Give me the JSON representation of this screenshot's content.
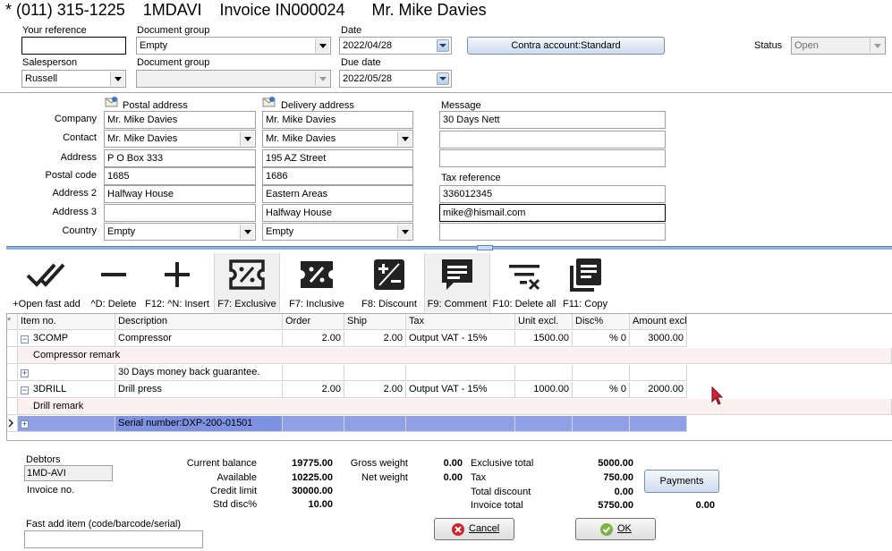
{
  "window": {
    "title": "* (011) 315-1225    1MDAVI    Invoice IN000024      Mr. Mike Davies"
  },
  "header": {
    "your_reference": {
      "label": "Your reference",
      "value": ""
    },
    "document_group1": {
      "label": "Document group",
      "value": "Empty"
    },
    "date": {
      "label": "Date",
      "value": "2022/04/28"
    },
    "contra_button": "Contra account:Standard",
    "status": {
      "label": "Status",
      "value": "Open"
    },
    "salesperson": {
      "label": "Salesperson",
      "value": "Russell"
    },
    "document_group2": {
      "label": "Document group",
      "value": ""
    },
    "due_date": {
      "label": "Due date",
      "value": "2022/05/28"
    }
  },
  "address": {
    "postal_header": "Postal address",
    "delivery_header": "Delivery address",
    "message_header": "Message",
    "tax_reference_header": "Tax reference",
    "row_labels": [
      "Company",
      "Contact",
      "Address",
      "Postal code",
      "Address 2",
      "Address 3",
      "Country"
    ],
    "postal": [
      "Mr. Mike Davies",
      "Mr. Mike Davies",
      "P O Box 333",
      "1685",
      "Halfway House",
      "",
      "Empty"
    ],
    "delivery": [
      "Mr. Mike Davies",
      "Mr. Mike Davies",
      "195 AZ Street",
      "1686",
      "Eastern Areas",
      "Halfway House",
      "Empty"
    ],
    "message": [
      "30 Days Nett",
      "",
      ""
    ],
    "tax_reference": "336012345",
    "email": "mike@hismail.com",
    "extra": ""
  },
  "toolbar": [
    {
      "label": "+Open fast add",
      "icon": "double-check-icon"
    },
    {
      "label": "^D: Delete",
      "icon": "minus-icon"
    },
    {
      "label": "F12: ^N: Insert",
      "icon": "plus-icon"
    },
    {
      "label": "F7: Exclusive",
      "icon": "ticket-percent-outline-icon"
    },
    {
      "label": "F7: Inclusive",
      "icon": "ticket-percent-icon"
    },
    {
      "label": "F8: Discount",
      "icon": "plus-minus-box-icon"
    },
    {
      "label": "F9: Comment",
      "icon": "comment-icon"
    },
    {
      "label": "F10: Delete all",
      "icon": "filter-remove-icon"
    },
    {
      "label": "F11: Copy",
      "icon": "copy-pages-icon"
    }
  ],
  "grid": {
    "columns": [
      "*",
      "Item no.",
      "Description",
      "Order",
      "Ship",
      "Tax",
      "Unit excl.",
      "Disc%",
      "Amount excl"
    ],
    "rows": [
      {
        "kind": "item",
        "item": "3COMP",
        "desc": "Compressor",
        "order": "2.00",
        "ship": "2.00",
        "tax": "Output VAT - 15%",
        "unit": "1500.00",
        "disc_sym": "%",
        "disc": "0",
        "amount": "3000.00"
      },
      {
        "kind": "remark",
        "text": "Compressor remark"
      },
      {
        "kind": "comment",
        "desc": "30 Days money back guarantee."
      },
      {
        "kind": "item",
        "item": "3DRILL",
        "desc": "Drill press",
        "order": "2.00",
        "ship": "2.00",
        "tax": "Output VAT - 15%",
        "unit": "1000.00",
        "disc_sym": "%",
        "disc": "0",
        "amount": "2000.00"
      },
      {
        "kind": "remark",
        "text": "Drill remark"
      },
      {
        "kind": "selected",
        "desc": "Serial number:DXP-200-01501"
      }
    ]
  },
  "footer": {
    "debtors_label": "Debtors",
    "debtor_code": "1MD-AVI",
    "invoice_no_label": "Invoice no.",
    "fast_add_label": "Fast add item (code/barcode/serial)",
    "fast_add_value": "",
    "balances": [
      {
        "label": "Current balance",
        "value": "19775.00"
      },
      {
        "label": "Available",
        "value": "10225.00"
      },
      {
        "label": "Credit limit",
        "value": "30000.00"
      },
      {
        "label": "Std disc%",
        "value": "10.00"
      }
    ],
    "weights": [
      {
        "label": "Gross weight",
        "value": "0.00"
      },
      {
        "label": "Net weight",
        "value": "0.00"
      }
    ],
    "totals": [
      {
        "label": "Exclusive total",
        "value": "5000.00"
      },
      {
        "label": "Tax",
        "value": "750.00"
      },
      {
        "label": "Total discount",
        "value": "0.00"
      },
      {
        "label": "Invoice total",
        "value": "5750.00"
      }
    ],
    "payments_button": "Payments",
    "payments_value": "0.00",
    "cancel_button": "Cancel",
    "ok_button": "OK"
  }
}
